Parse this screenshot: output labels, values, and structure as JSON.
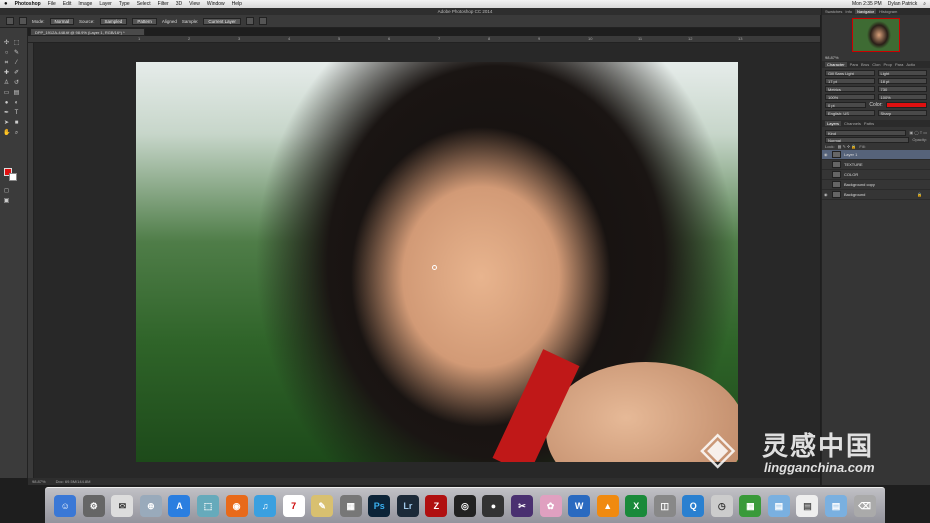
{
  "menubar": {
    "app": "Photoshop",
    "items": [
      "File",
      "Edit",
      "Image",
      "Layer",
      "Type",
      "Select",
      "Filter",
      "3D",
      "View",
      "Window",
      "Help"
    ],
    "clock": "Mon 2:35 PM",
    "user": "Dylan Patrick"
  },
  "window": {
    "title": "Adobe Photoshop CC 2014"
  },
  "options": {
    "mode_label": "Mode:",
    "mode_value": "Normal",
    "source_label": "Source:",
    "sampled": "Sampled",
    "pattern": "Pattern",
    "aligned": "Aligned",
    "sample_label": "Sample:",
    "sample_value": "Current Layer"
  },
  "document": {
    "tab": "DPP_1912A-448.tif @ 98.9% (Layer 1, RGB/16*) *",
    "status_zoom": "98.87%",
    "status_doc": "Doc: 69.5M/144.8M"
  },
  "ruler": [
    "1",
    "2",
    "3",
    "4",
    "5",
    "6",
    "7",
    "8",
    "9",
    "10",
    "11",
    "12",
    "13"
  ],
  "panels": {
    "top_tabs": [
      "Swatches",
      "Info",
      "Navigator",
      "Histogram"
    ],
    "active_top": "Navigator",
    "nav_zoom": "98.87%",
    "char_tabs": [
      "Character",
      "Para",
      "Brus",
      "Clon",
      "Prop",
      "Para",
      "Actio"
    ],
    "font_family": "Gill Sans Light",
    "font_style": "Light",
    "font_size": "17 pt",
    "leading": "18 pt",
    "kerning": "Metrics",
    "tracking": "730",
    "vscale": "100%",
    "hscale": "100%",
    "baseline": "0 pt",
    "color_label": "Color:",
    "language": "English: US",
    "aa": "Sharp",
    "layer_tabs": [
      "Layers",
      "Channels",
      "Paths"
    ],
    "blend_kind": "Kind",
    "blend_mode": "Normal",
    "opacity_label": "Opacity:",
    "lock_label": "Lock:",
    "fill_label": "Fill:"
  },
  "layers": [
    {
      "name": "Layer 1",
      "selected": true
    },
    {
      "name": "TEXTURE",
      "selected": false
    },
    {
      "name": "COLOR",
      "selected": false
    },
    {
      "name": "Background copy",
      "selected": false
    },
    {
      "name": "Background",
      "selected": false
    }
  ],
  "dock": [
    "Finder",
    "Launchpad",
    "Mail",
    "Safari",
    "App Store",
    "Preview",
    "Firefox",
    "iTunes",
    "Calendar",
    "Notes",
    "Photo Booth",
    "Ps",
    "Lr",
    "FileZilla",
    "Cam Ranger",
    "Capture One",
    "Final Cut",
    "Team",
    "Word",
    "VLC",
    "Excel",
    "Screenshot",
    "QuickTime",
    "Time Machine",
    "Spaces",
    "Downloads",
    "Documents",
    "Folder",
    "Trash"
  ],
  "watermark": {
    "cn": "灵感中国",
    "en": "lingganchina.com"
  },
  "colors": {
    "foreground": "#e01010",
    "background": "#ffffff",
    "accent": "#56637a"
  }
}
